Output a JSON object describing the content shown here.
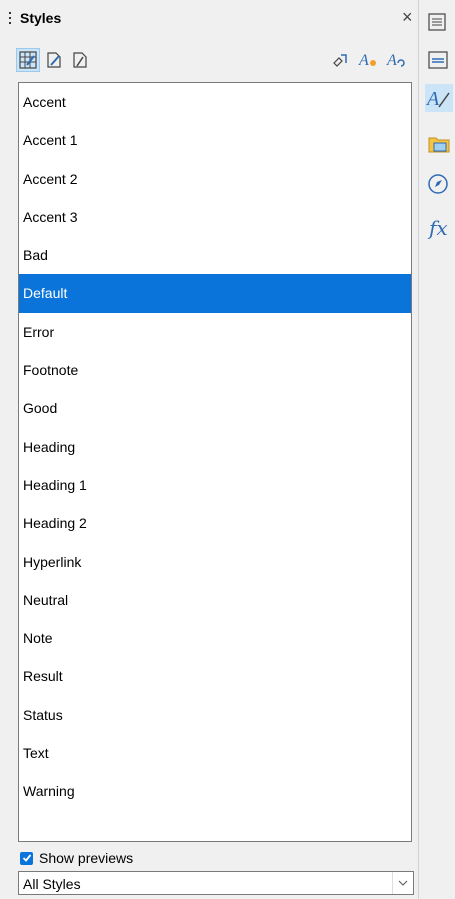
{
  "panel": {
    "title": "Styles",
    "close_label": "×"
  },
  "toolbar": {
    "left_icons": [
      "cell-styles-icon",
      "page-styles-icon",
      "drawing-styles-icon"
    ],
    "right_icons": [
      "fill-format-mode-icon",
      "new-style-icon",
      "update-style-icon"
    ]
  },
  "styles": [
    {
      "label": "Accent"
    },
    {
      "label": "Accent 1"
    },
    {
      "label": "Accent 2"
    },
    {
      "label": "Accent 3"
    },
    {
      "label": "Bad"
    },
    {
      "label": "Default",
      "selected": true
    },
    {
      "label": "Error"
    },
    {
      "label": "Footnote"
    },
    {
      "label": "Good"
    },
    {
      "label": "Heading"
    },
    {
      "label": "Heading 1"
    },
    {
      "label": "Heading 2"
    },
    {
      "label": "Hyperlink"
    },
    {
      "label": "Neutral"
    },
    {
      "label": "Note"
    },
    {
      "label": "Result"
    },
    {
      "label": "Status"
    },
    {
      "label": "Text"
    },
    {
      "label": "Warning"
    }
  ],
  "previews": {
    "label": "Show previews",
    "checked": true
  },
  "filter": {
    "value": "All Styles"
  },
  "sidebar": {
    "icons": [
      "sidebar-menu-icon",
      "properties-icon",
      "styles-icon",
      "gallery-icon",
      "navigator-icon",
      "functions-icon"
    ],
    "functions_label": "fx"
  },
  "colors": {
    "accent": "#0a74da",
    "active_bg": "#cce4f7"
  }
}
